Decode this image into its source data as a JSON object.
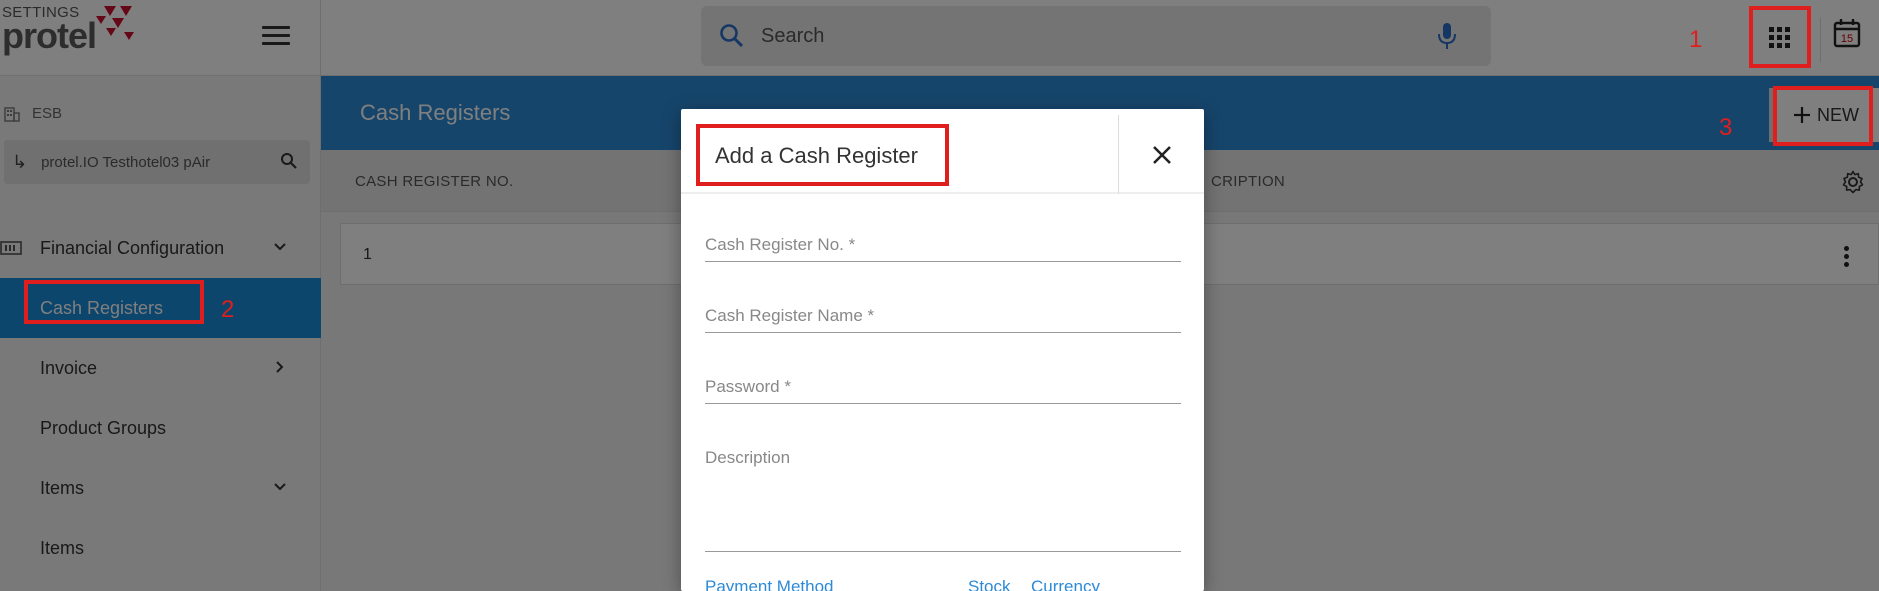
{
  "app": {
    "logo_settings": "SETTINGS",
    "logo_name": "protel",
    "search_placeholder": "Search"
  },
  "sidebar": {
    "context_label": "ESB",
    "hotel_name": "protel.IO Testhotel03 pAir",
    "items": [
      {
        "label": "Financial Configuration",
        "chevron": "down"
      },
      {
        "label": "Cash Registers",
        "active": true
      },
      {
        "label": "Invoice",
        "chevron": "right"
      },
      {
        "label": "Product Groups"
      },
      {
        "label": "Items",
        "chevron": "down"
      },
      {
        "label": "Items"
      }
    ]
  },
  "topbar": {
    "calendar_day": "15"
  },
  "page": {
    "title": "Cash Registers",
    "new_label": "NEW",
    "columns": [
      "CASH REGISTER NO.",
      "CRIPTION"
    ],
    "rows": [
      {
        "no": "1"
      }
    ]
  },
  "modal": {
    "title": "Add a Cash Register",
    "fields": {
      "register_no": "Cash Register No. *",
      "register_name": "Cash Register Name *",
      "password": "Password *",
      "description": "Description"
    },
    "tabs": [
      "Payment Method",
      "Stock",
      "Currency"
    ]
  },
  "annotations": {
    "color": "#e01e1e",
    "labels": [
      "1",
      "2",
      "3"
    ]
  },
  "colors": {
    "accent": "#2c8ad6",
    "active_nav": "#1a8cd8"
  }
}
